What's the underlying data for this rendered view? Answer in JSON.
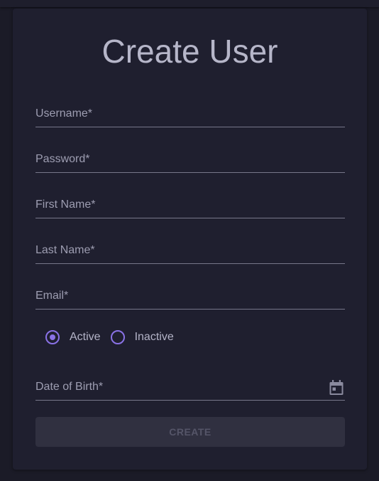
{
  "form": {
    "title": "Create User",
    "fields": {
      "username": {
        "label": "Username*",
        "value": ""
      },
      "password": {
        "label": "Password*",
        "value": ""
      },
      "first_name": {
        "label": "First Name*",
        "value": ""
      },
      "last_name": {
        "label": "Last Name*",
        "value": ""
      },
      "email": {
        "label": "Email*",
        "value": ""
      },
      "dob": {
        "label": "Date of Birth*",
        "value": ""
      }
    },
    "status": {
      "options": [
        "Active",
        "Inactive"
      ],
      "selected": "Active"
    },
    "create_label": "CREATE"
  },
  "theme": {
    "accent": "#8a72e6",
    "background": "#1b1b27",
    "surface": "#1f1f2f",
    "button_disabled": "#303040"
  },
  "icons": {
    "date_picker": "calendar-icon"
  }
}
